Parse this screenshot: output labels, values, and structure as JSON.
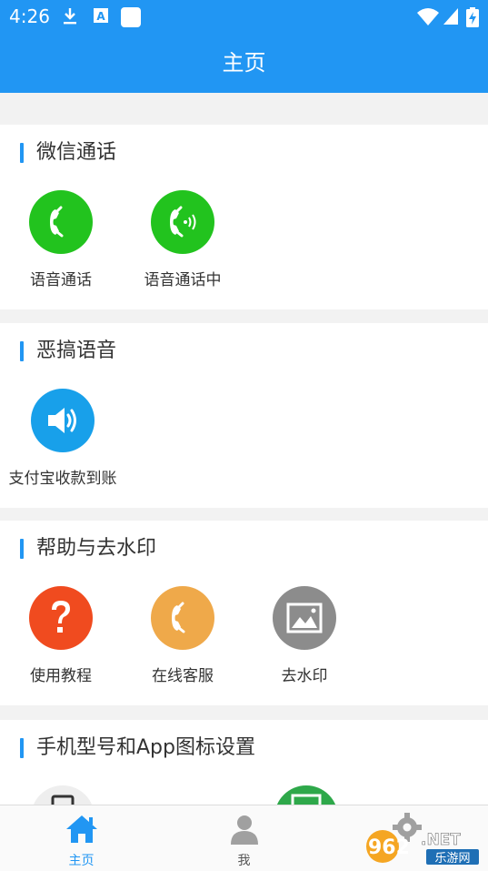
{
  "status_bar": {
    "time": "4:26",
    "icons": [
      "download-icon",
      "a-badge-icon",
      "square-icon",
      "wifi-icon",
      "signal-icon",
      "battery-charging-icon"
    ]
  },
  "header": {
    "title": "主页"
  },
  "sections": [
    {
      "title": "微信通话",
      "items": [
        {
          "label": "语音通话",
          "icon": "phone-icon",
          "color": "#22c31e"
        },
        {
          "label": "语音通话中",
          "icon": "phone-active-icon",
          "color": "#22c31e"
        }
      ]
    },
    {
      "title": "恶搞语音",
      "items": [
        {
          "label": "支付宝收款到账",
          "icon": "speaker-icon",
          "color": "#18a0ea"
        }
      ]
    },
    {
      "title": "帮助与去水印",
      "items": [
        {
          "label": "使用教程",
          "icon": "question-icon",
          "color": "#f04b1f"
        },
        {
          "label": "在线客服",
          "icon": "phone-icon",
          "color": "#efa94a"
        },
        {
          "label": "去水印",
          "icon": "image-icon",
          "color": "#8c8c8c"
        }
      ]
    },
    {
      "title": "手机型号和App图标设置",
      "items": []
    }
  ],
  "bottom_nav": {
    "items": [
      {
        "label": "主页",
        "icon": "home-icon",
        "active": true
      },
      {
        "label": "我",
        "icon": "person-icon",
        "active": false
      },
      {
        "label": "",
        "icon": "gear-icon",
        "active": false
      }
    ],
    "active_color": "#2196f3",
    "inactive_color": "#9e9e9e"
  },
  "watermark": {
    "brand": "962.NET",
    "site": "乐游网"
  }
}
